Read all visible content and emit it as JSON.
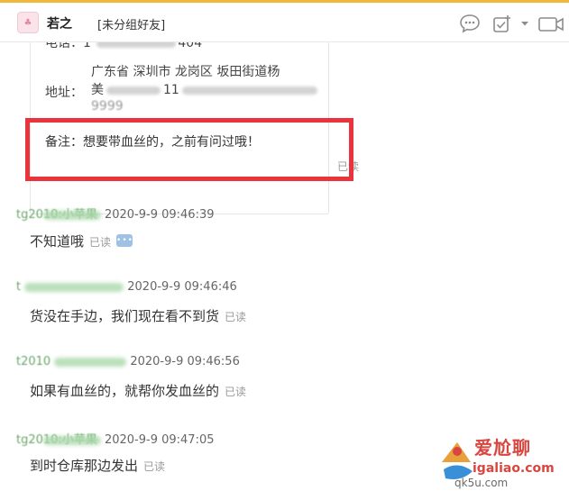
{
  "header": {
    "avatar_glyph": "♣",
    "contact_name": "若之",
    "contact_group": "[未分组好友]",
    "icons": [
      "chat-bubble-icon",
      "add-task-icon",
      "dropdown-arrow-icon",
      "video-call-icon"
    ]
  },
  "card": {
    "phone_label": "电话：",
    "phone_visible": "1",
    "phone_suffix": "404",
    "address_label": "地址：",
    "address_line1": "广东省 深圳市 龙岗区 坂田街道杨",
    "address_line2": "美",
    "address_line2_mid": "11",
    "address_line3": "9999",
    "note_label": "备注：",
    "note_text": "想要带血丝的，之前有问过哦！",
    "read_status": "已读"
  },
  "messages": [
    {
      "sender": "tg2010:小苹果",
      "time": "2020-9-9 09:46:39",
      "text": "不知道哦",
      "read": "已读",
      "has_more": true
    },
    {
      "sender": "t",
      "time": "2020-9-9 09:46:46",
      "text": "货没在手边，我们现在看不到货",
      "read": "已读",
      "has_more": false
    },
    {
      "sender": "t2010",
      "time": "2020-9-9 09:46:56",
      "text": "如果有血丝的，就帮你发血丝的",
      "read": "已读",
      "has_more": false
    },
    {
      "sender": "tg2010:小苹果",
      "time": "2020-9-9 09:47:05",
      "text": "到时仓库那边发出",
      "read": "已读",
      "has_more": false
    }
  ],
  "watermark": {
    "title": "爱尬聊",
    "url": "igaliao.com",
    "bottom": "qk5u.com"
  },
  "colors": {
    "highlight_border": "#e8343a",
    "top_accent": "#f0b93a",
    "sender_green": "#6aa66a",
    "read_gray": "#9a9a9a"
  }
}
